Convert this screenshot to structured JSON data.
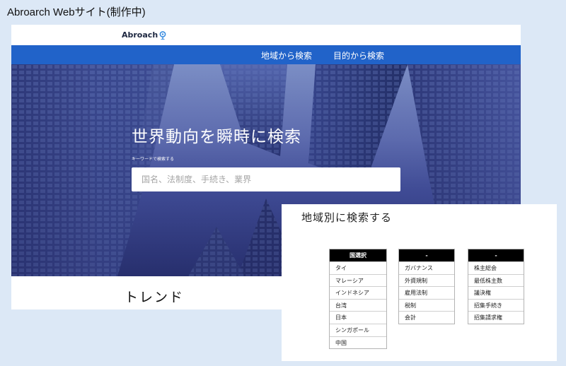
{
  "caption": "Abroarch Webサイト(制作中)",
  "header": {
    "logo_text": "Abroach",
    "nav": [
      "地域から検索",
      "目的から検索"
    ]
  },
  "hero": {
    "title": "世界動向を瞬時に検索",
    "keyword_label": "キーワードで検索する",
    "search_placeholder": "国名、法制度、手続き、業界"
  },
  "trend": {
    "title": "トレンド"
  },
  "panel": {
    "title": "地域別に検索する",
    "dropdowns": [
      {
        "header": "国選択",
        "items": [
          "タイ",
          "マレーシア",
          "インドネシア",
          "台湾",
          "日本",
          "シンガポール",
          "中国"
        ]
      },
      {
        "header": "-",
        "items": [
          "ガバナンス",
          "外資規制",
          "雇用法制",
          "税制",
          "会計"
        ]
      },
      {
        "header": "-",
        "items": [
          "株主総会",
          "最低株主数",
          "議決権",
          "招集手続き",
          "招集請求権"
        ]
      }
    ]
  },
  "colors": {
    "background": "#dce8f6",
    "nav_blue": "#2163c9",
    "logo_pin": "#3a8de0"
  }
}
